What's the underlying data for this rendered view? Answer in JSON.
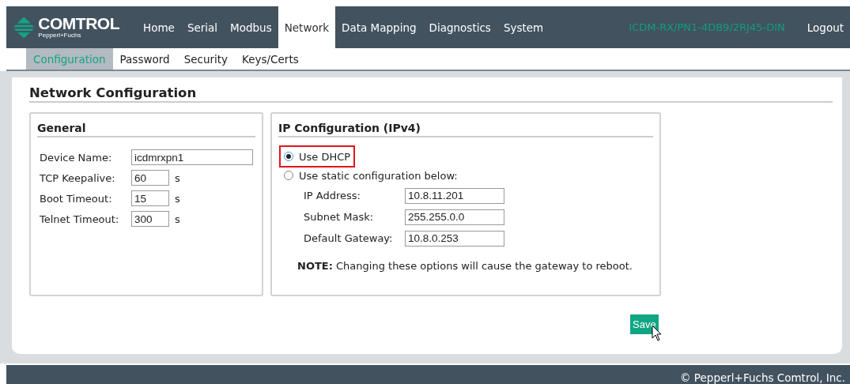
{
  "logo": {
    "name": "COMTROL",
    "tagline": "Pepperl+Fuchs"
  },
  "nav": [
    {
      "label": "Home",
      "selected": false
    },
    {
      "label": "Serial",
      "selected": false
    },
    {
      "label": "Modbus",
      "selected": false
    },
    {
      "label": "Network",
      "selected": true
    },
    {
      "label": "Data Mapping",
      "selected": false
    },
    {
      "label": "Diagnostics",
      "selected": false
    },
    {
      "label": "System",
      "selected": false
    }
  ],
  "device_model": "ICDM-RX/PN1-4DB9/2RJ45-DIN",
  "logout": "Logout",
  "subnav": [
    {
      "label": "Configuration",
      "selected": true
    },
    {
      "label": "Password",
      "selected": false
    },
    {
      "label": "Security",
      "selected": false
    },
    {
      "label": "Keys/Certs",
      "selected": false
    }
  ],
  "page_title": "Network Configuration",
  "general": {
    "title": "General",
    "fields": [
      {
        "label": "Device Name:",
        "value": "icdmrxpn1",
        "kind": "wide"
      },
      {
        "label": "TCP Keepalive:",
        "value": "60",
        "unit": "s",
        "kind": "short"
      },
      {
        "label": "Boot Timeout:",
        "value": "15",
        "unit": "s",
        "kind": "short"
      },
      {
        "label": "Telnet Timeout:",
        "value": "300",
        "unit": "s",
        "kind": "short"
      }
    ]
  },
  "ip": {
    "title": "IP Configuration (IPv4)",
    "options": [
      {
        "label": "Use DHCP",
        "selected": true,
        "highlighted": true
      },
      {
        "label": "Use static configuration below:",
        "selected": false,
        "highlighted": false
      }
    ],
    "fields": [
      {
        "label": "IP Address:",
        "value": "10.8.11.201"
      },
      {
        "label": "Subnet Mask:",
        "value": "255.255.0.0"
      },
      {
        "label": "Default Gateway:",
        "value": "10.8.0.253"
      }
    ],
    "note": "**NOTE:** Changing these options will cause the gateway to reboot."
  },
  "save": "Save",
  "footer": "© Pepperl+Fuchs Comtrol, Inc."
}
